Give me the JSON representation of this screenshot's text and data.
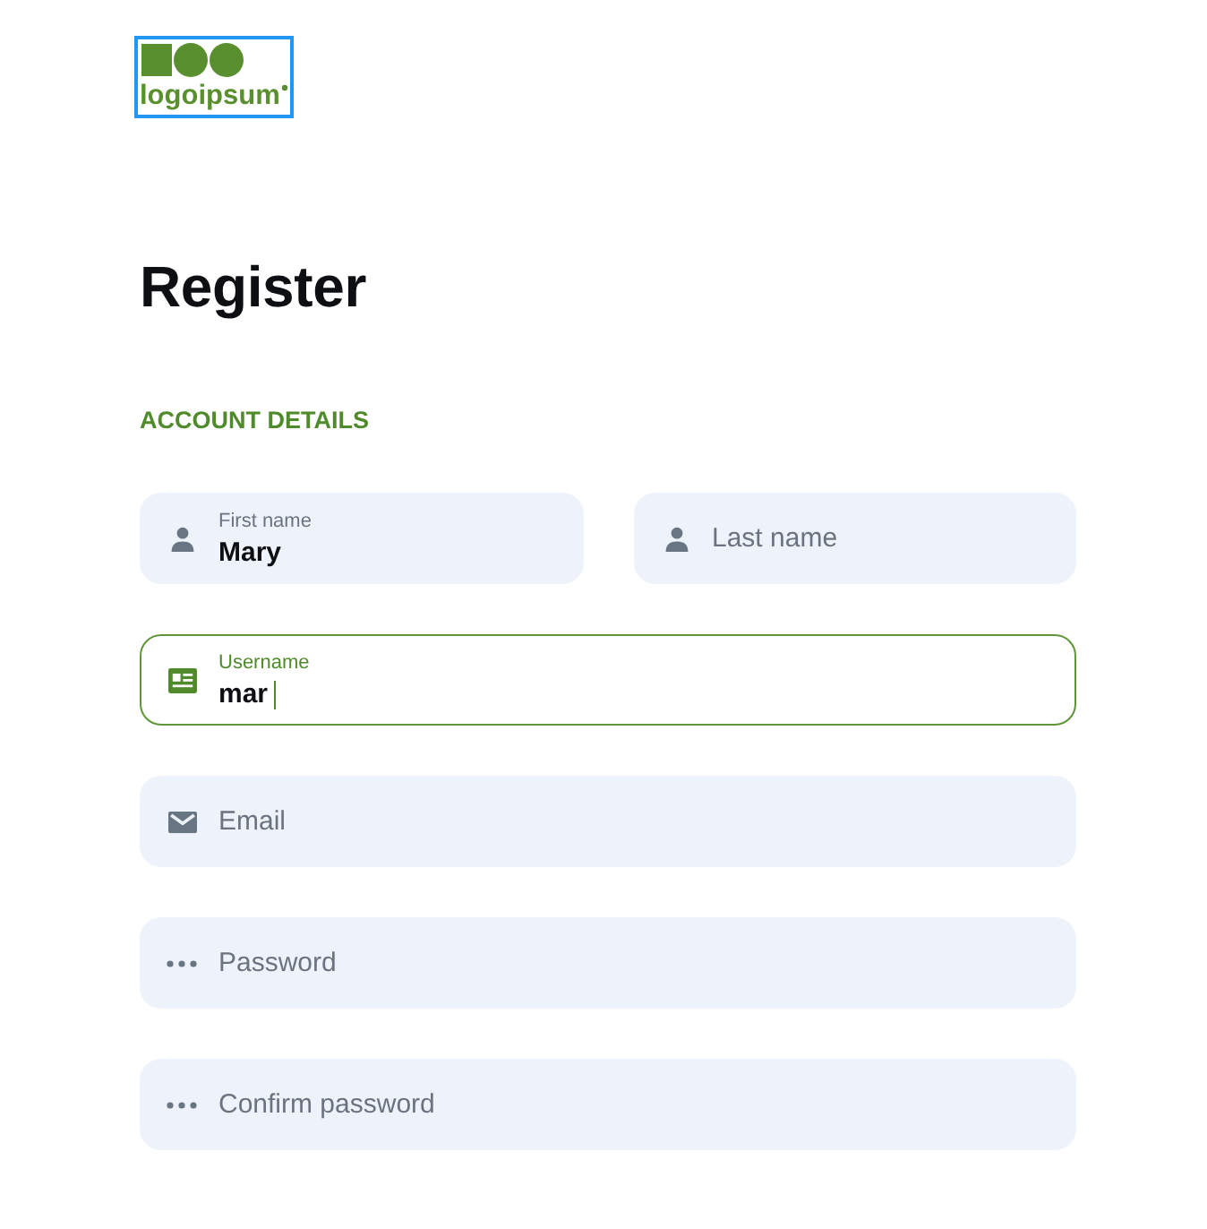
{
  "logo": {
    "text": "logoipsum",
    "focused": true
  },
  "heading": "Register",
  "section_title": "ACCOUNT DETAILS",
  "rows": [
    {
      "fields": [
        {
          "kind": "name",
          "label": "First name",
          "value": "Mary",
          "focused": false
        },
        {
          "kind": "name",
          "placeholder": "Last name",
          "focused": false
        }
      ]
    },
    {
      "fields": [
        {
          "kind": "username",
          "label": "Username",
          "value": "mar",
          "focused": true
        }
      ]
    },
    {
      "fields": [
        {
          "kind": "email",
          "placeholder": "Email",
          "focused": false
        }
      ]
    },
    {
      "fields": [
        {
          "kind": "password",
          "placeholder": "Password",
          "focused": false
        }
      ]
    },
    {
      "fields": [
        {
          "kind": "password",
          "placeholder": "Confirm password",
          "focused": false
        }
      ]
    }
  ]
}
